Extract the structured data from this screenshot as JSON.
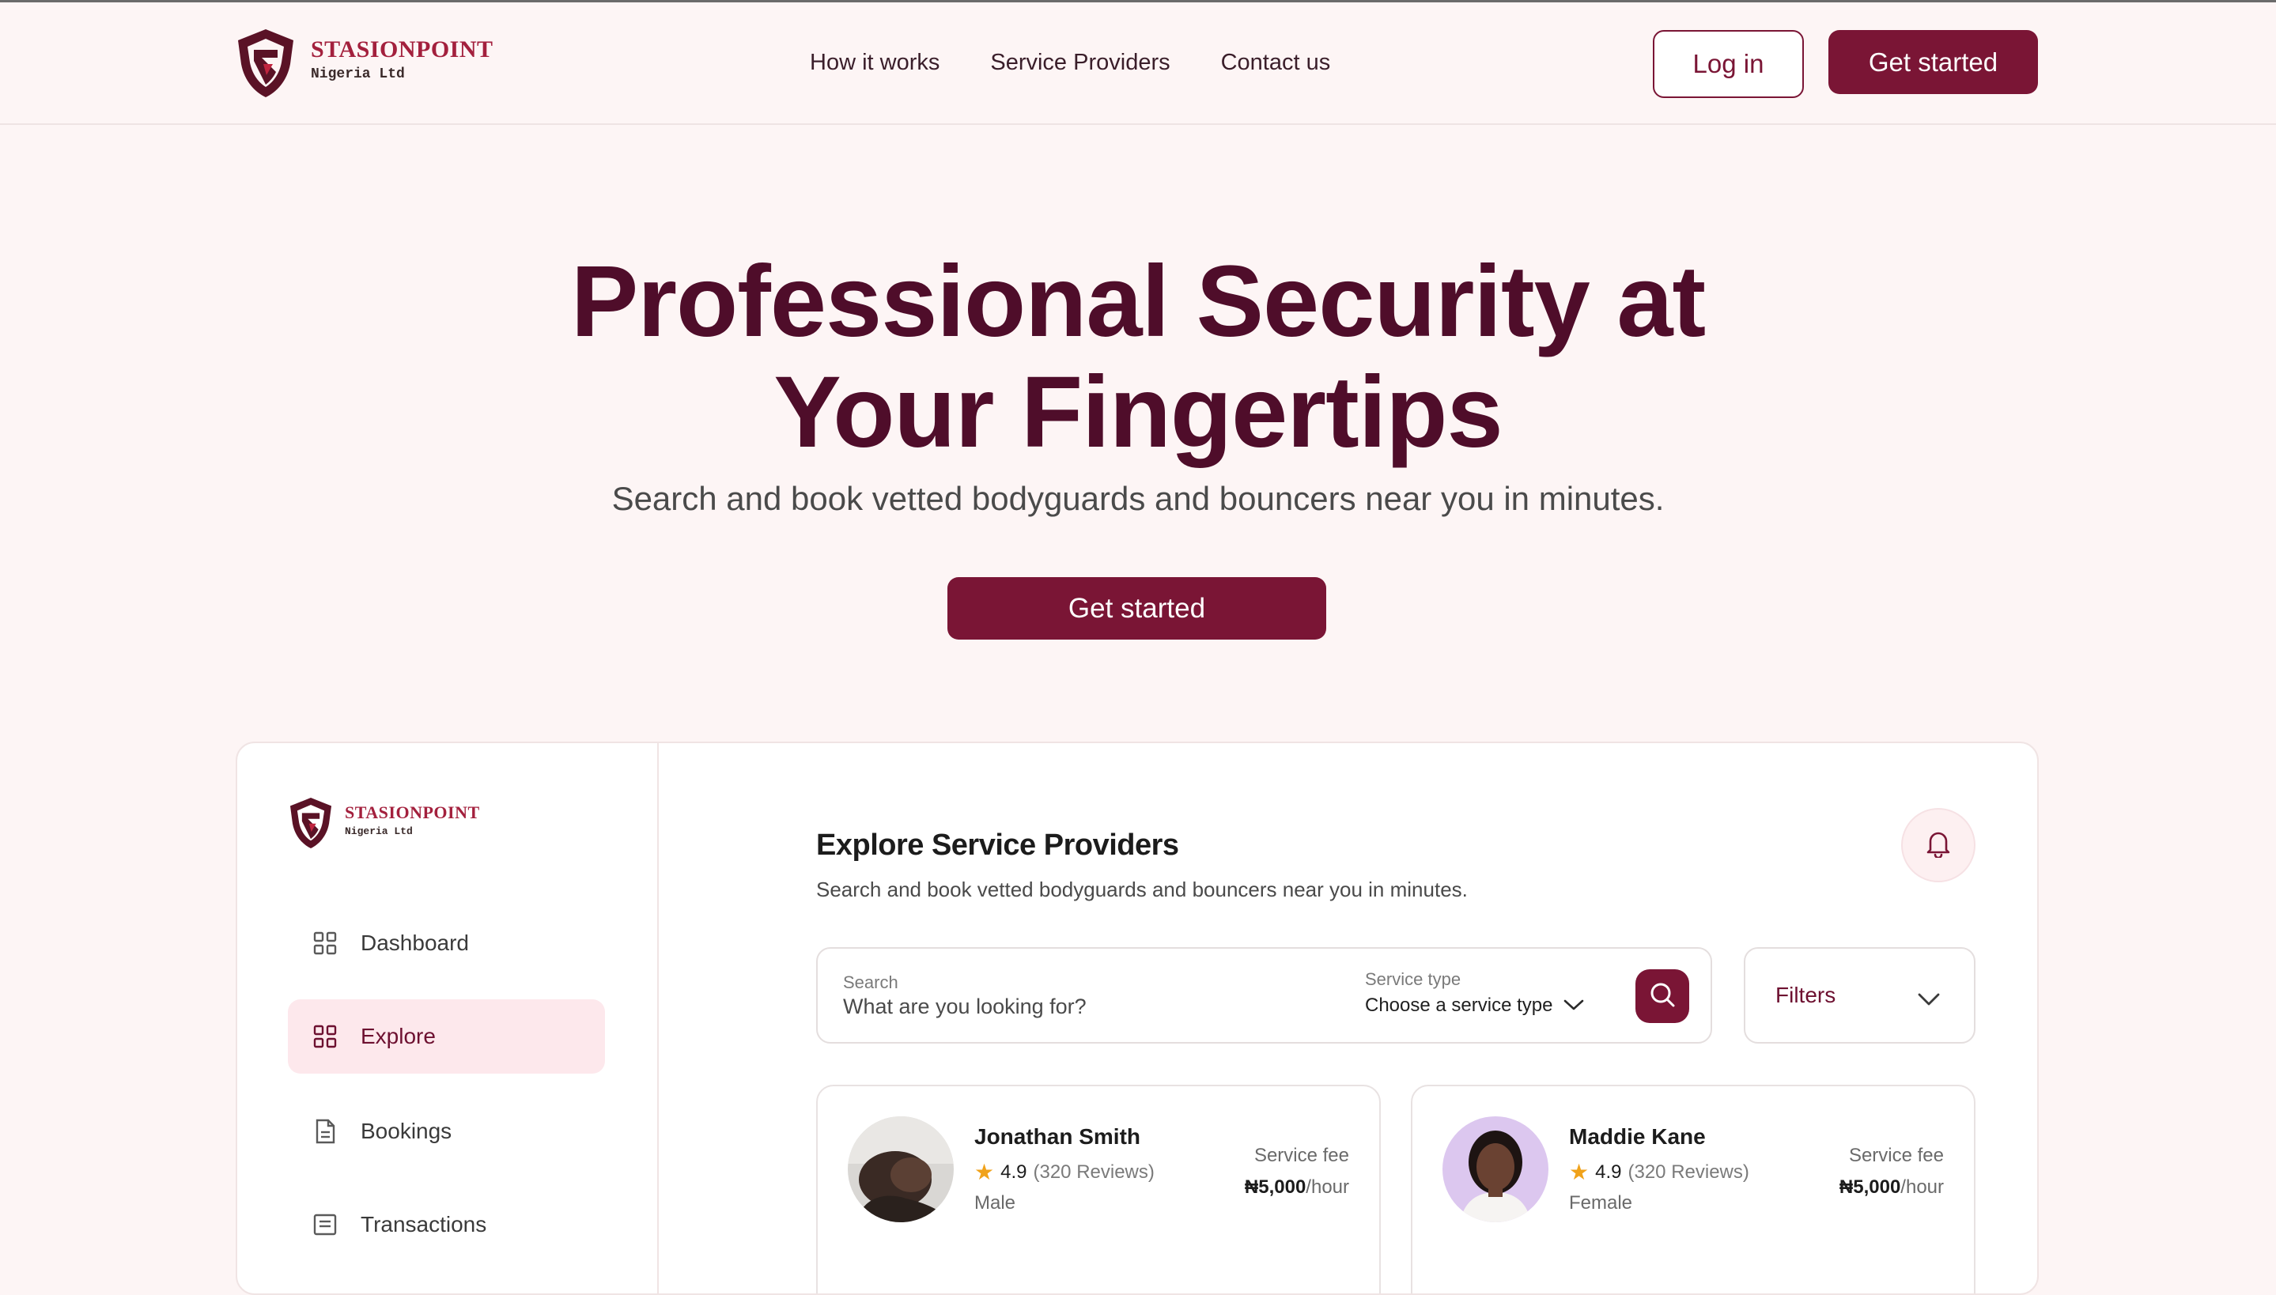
{
  "brand": {
    "name": "STASIONPOINT",
    "sub": "Nigeria Ltd"
  },
  "nav": {
    "links": [
      "How it works",
      "Service Providers",
      "Contact us"
    ],
    "login_label": "Log in",
    "get_started_label": "Get started"
  },
  "hero": {
    "title_line1": "Professional Security at",
    "title_line2": "Your Fingertips",
    "subtitle": "Search and book vetted bodyguards and bouncers near you in minutes.",
    "cta_label": "Get started"
  },
  "colors": {
    "primary": "#7a1535",
    "heading": "#4f0d2a",
    "background": "#fdf5f5",
    "active_bg": "#fde8ec",
    "star": "#f0a21a"
  },
  "sidebar": {
    "items": [
      {
        "label": "Dashboard",
        "icon": "grid-icon",
        "active": false
      },
      {
        "label": "Explore",
        "icon": "grid-icon",
        "active": true
      },
      {
        "label": "Bookings",
        "icon": "document-icon",
        "active": false
      },
      {
        "label": "Transactions",
        "icon": "receipt-icon",
        "active": false
      }
    ]
  },
  "main": {
    "title": "Explore Service Providers",
    "subtitle": "Search and book vetted bodyguards and bouncers near you in minutes.",
    "search": {
      "label": "Search",
      "placeholder": "What are you looking for?"
    },
    "service_type": {
      "label": "Service type",
      "value": "Choose a service type"
    },
    "filters_label": "Filters"
  },
  "providers": [
    {
      "name": "Jonathan Smith",
      "rating": "4.9",
      "reviews": "(320 Reviews)",
      "gender": "Male",
      "fee_label": "Service fee",
      "fee": "₦5,000",
      "fee_unit": "/hour"
    },
    {
      "name": "Maddie Kane",
      "rating": "4.9",
      "reviews": "(320 Reviews)",
      "gender": "Female",
      "fee_label": "Service fee",
      "fee": "₦5,000",
      "fee_unit": "/hour"
    }
  ]
}
